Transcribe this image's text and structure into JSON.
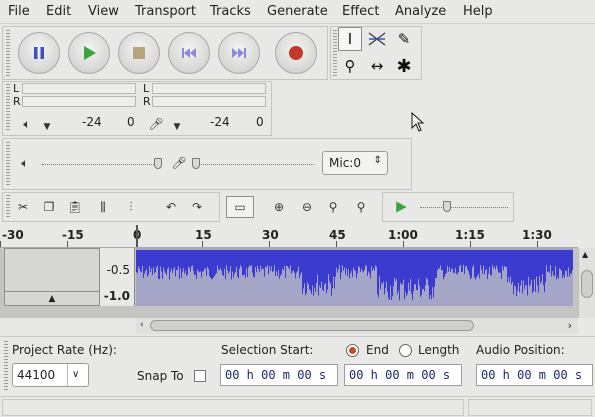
{
  "menu": [
    "File",
    "Edit",
    "View",
    "Transport",
    "Tracks",
    "Generate",
    "Effect",
    "Analyze",
    "Help"
  ],
  "meters": {
    "channel_l": "L",
    "channel_r": "R",
    "playback_ticks": [
      "-24",
      "0"
    ],
    "record_ticks": [
      "-24",
      "0"
    ]
  },
  "mixer": {
    "input_device": "Mic:0"
  },
  "ruler": {
    "labels": [
      "-30",
      "-15",
      "0",
      "15",
      "30",
      "45",
      "1:00",
      "1:15",
      "1:30"
    ]
  },
  "track": {
    "scale_labels": [
      "-0.5",
      "-1.0"
    ]
  },
  "selection": {
    "project_rate_label": "Project Rate (Hz):",
    "project_rate_value": "44100",
    "snap_to_label": "Snap To",
    "selection_start_label": "Selection Start:",
    "end_label": "End",
    "length_label": "Length",
    "audio_position_label": "Audio Position:",
    "selection_start_value": "00 h 00 m 00 s",
    "end_value": "00 h 00 m 00 s",
    "audio_position_value": "00 h 00 m 00 s"
  },
  "colors": {
    "waveform": "#3b3bd0",
    "waveform_bg": "#a5a5c8",
    "record": "#c0392b",
    "play": "#3aa53a",
    "pause": "#3b50c8"
  },
  "icons": [
    "pause-icon",
    "play-icon",
    "stop-icon",
    "skip-start-icon",
    "skip-end-icon",
    "record-icon",
    "selection-tool-icon",
    "envelope-tool-icon",
    "draw-tool-icon",
    "zoom-tool-icon",
    "timeshift-tool-icon",
    "multi-tool-icon",
    "speaker-icon",
    "microphone-icon",
    "cut-icon",
    "copy-icon",
    "paste-icon",
    "trim-icon",
    "silence-icon",
    "undo-icon",
    "redo-icon",
    "sync-lock-icon",
    "zoom-in-icon",
    "zoom-out-icon",
    "fit-selection-icon",
    "fit-project-icon",
    "play-at-speed-icon",
    "cursor-icon"
  ]
}
